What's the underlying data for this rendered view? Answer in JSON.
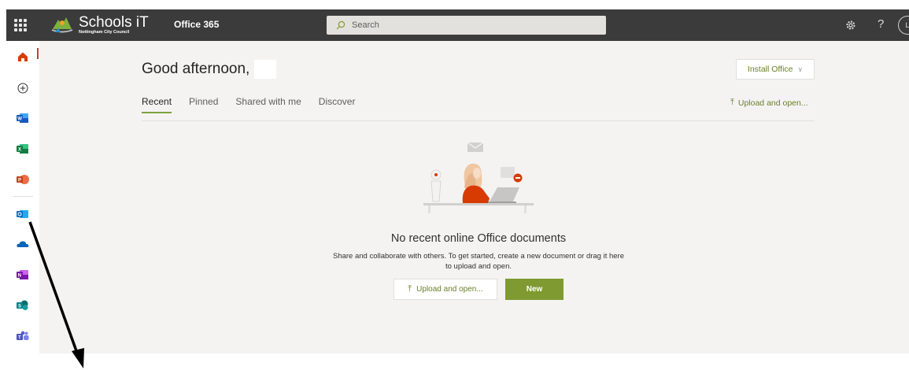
{
  "header": {
    "logo_main": "Schools iT",
    "logo_sub": "Nottingham City Council",
    "suite_name": "Office 365",
    "search_placeholder": "Search",
    "avatar_initial": "L"
  },
  "rail": {
    "items": [
      {
        "name": "home",
        "color": "#d83b01"
      },
      {
        "name": "create",
        "color": "#323130"
      },
      {
        "name": "word",
        "color": "#185abd"
      },
      {
        "name": "excel",
        "color": "#107c41"
      },
      {
        "name": "powerpoint",
        "color": "#c43e1c"
      },
      {
        "name": "outlook",
        "color": "#0f6cbd"
      },
      {
        "name": "onedrive",
        "color": "#0364b8"
      },
      {
        "name": "onenote",
        "color": "#7719aa"
      },
      {
        "name": "sharepoint",
        "color": "#038387"
      },
      {
        "name": "teams",
        "color": "#5b5fc7"
      }
    ]
  },
  "main": {
    "greeting": "Good afternoon,",
    "install_label": "Install Office",
    "tabs": [
      "Recent",
      "Pinned",
      "Shared with me",
      "Discover"
    ],
    "active_tab": "Recent",
    "upload_label": "Upload and open...",
    "empty_title": "No recent online Office documents",
    "empty_desc_line1": "Share and collaborate with others. To get started, create a new document or drag it here",
    "empty_desc_line2": "to upload and open.",
    "upload_button": "Upload and open...",
    "new_button": "New"
  },
  "colors": {
    "accent": "#7e9a31",
    "topbar": "#3b3b3b"
  }
}
